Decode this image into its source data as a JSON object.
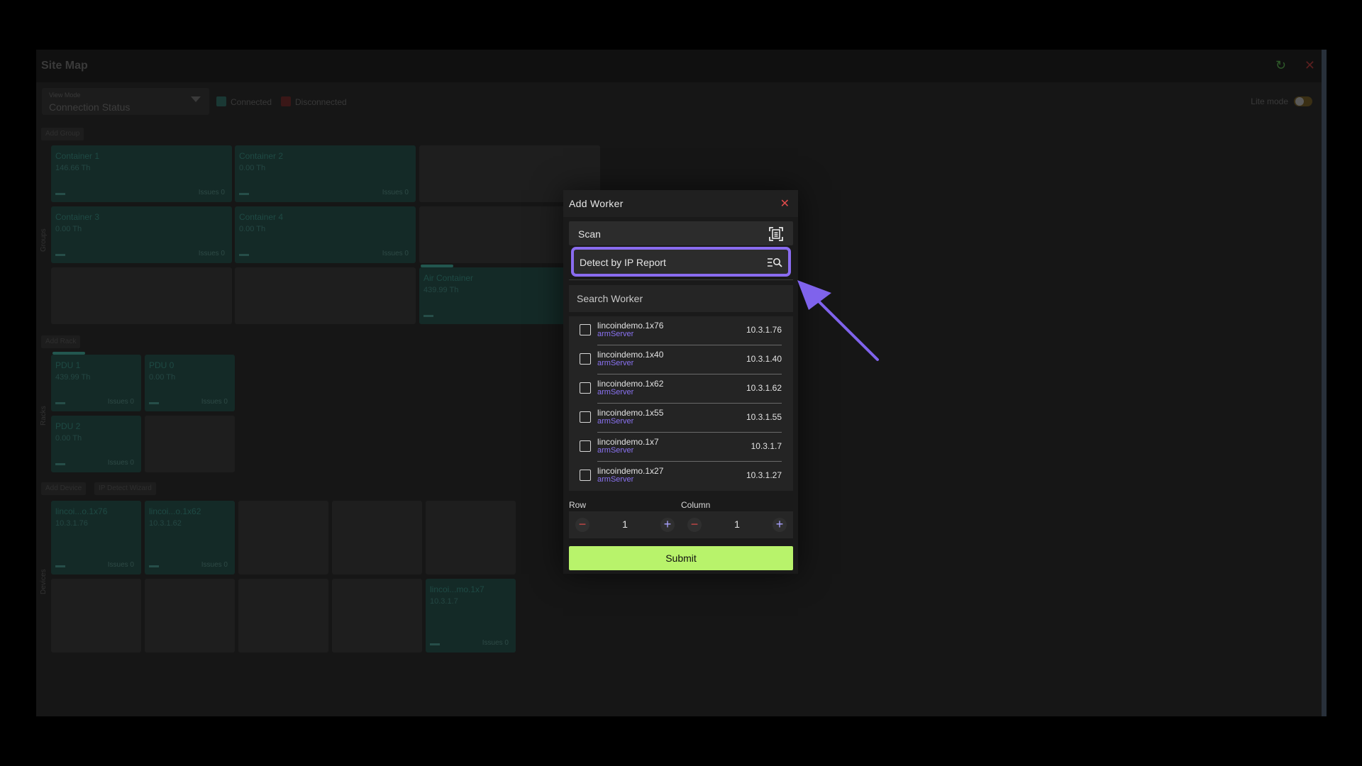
{
  "window": {
    "title": "Site Map",
    "view_mode_label": "View Mode",
    "view_mode_value": "Connection Status",
    "legend_connected": "Connected",
    "legend_disconnected": "Disconnected",
    "lite_mode": "Lite mode",
    "add_group": "Add Group",
    "add_rack": "Add Rack",
    "add_device": "Add Device",
    "ip_detect_wizard": "IP Detect Wizard",
    "side_groups": "Groups",
    "side_racks": "Racks",
    "side_devices": "Devices",
    "groups": [
      {
        "name": "Container 1",
        "sub": "146.66 Th",
        "issues": "Issues 0"
      },
      {
        "name": "Container 2",
        "sub": "0.00 Th",
        "issues": "Issues 0"
      },
      {
        "name": "Container 3",
        "sub": "0.00 Th",
        "issues": "Issues 0"
      },
      {
        "name": "Container 4",
        "sub": "0.00 Th",
        "issues": "Issues 0"
      },
      {
        "name": "Air Container",
        "sub": "439.99 Th",
        "issues": ""
      }
    ],
    "racks": [
      {
        "name": "PDU 1",
        "sub": "439.99 Th",
        "issues": "Issues 0"
      },
      {
        "name": "PDU 0",
        "sub": "0.00 Th",
        "issues": "Issues 0"
      },
      {
        "name": "PDU 2",
        "sub": "0.00 Th",
        "issues": "Issues 0"
      }
    ],
    "devices": [
      {
        "name": "lincoi...o.1x76",
        "sub": "10.3.1.76",
        "issues": "Issues 0"
      },
      {
        "name": "lincoi...o.1x62",
        "sub": "10.3.1.62",
        "issues": "Issues 0"
      },
      {
        "name": "lincoi...mo.1x7",
        "sub": "10.3.1.7",
        "issues": "Issues 0"
      }
    ]
  },
  "modal": {
    "title": "Add Worker",
    "close_icon": "close-icon",
    "scan_label": "Scan",
    "detect_label": "Detect by IP Report",
    "search_placeholder": "Search Worker",
    "workers": [
      {
        "name": "lincoindemo.1x76",
        "type": "armServer",
        "ip": "10.3.1.76"
      },
      {
        "name": "lincoindemo.1x40",
        "type": "armServer",
        "ip": "10.3.1.40"
      },
      {
        "name": "lincoindemo.1x62",
        "type": "armServer",
        "ip": "10.3.1.62"
      },
      {
        "name": "lincoindemo.1x55",
        "type": "armServer",
        "ip": "10.3.1.55"
      },
      {
        "name": "lincoindemo.1x7",
        "type": "armServer",
        "ip": "10.3.1.7"
      },
      {
        "name": "lincoindemo.1x27",
        "type": "armServer",
        "ip": "10.3.1.27"
      }
    ],
    "row_label": "Row",
    "row_value": "1",
    "column_label": "Column",
    "column_value": "1",
    "minus": "−",
    "plus": "+",
    "submit_label": "Submit"
  },
  "colors": {
    "accent": "#8a6cf0",
    "submit": "#b8f36b",
    "close": "#e04b4b",
    "worker_type": "#8a72f2"
  }
}
